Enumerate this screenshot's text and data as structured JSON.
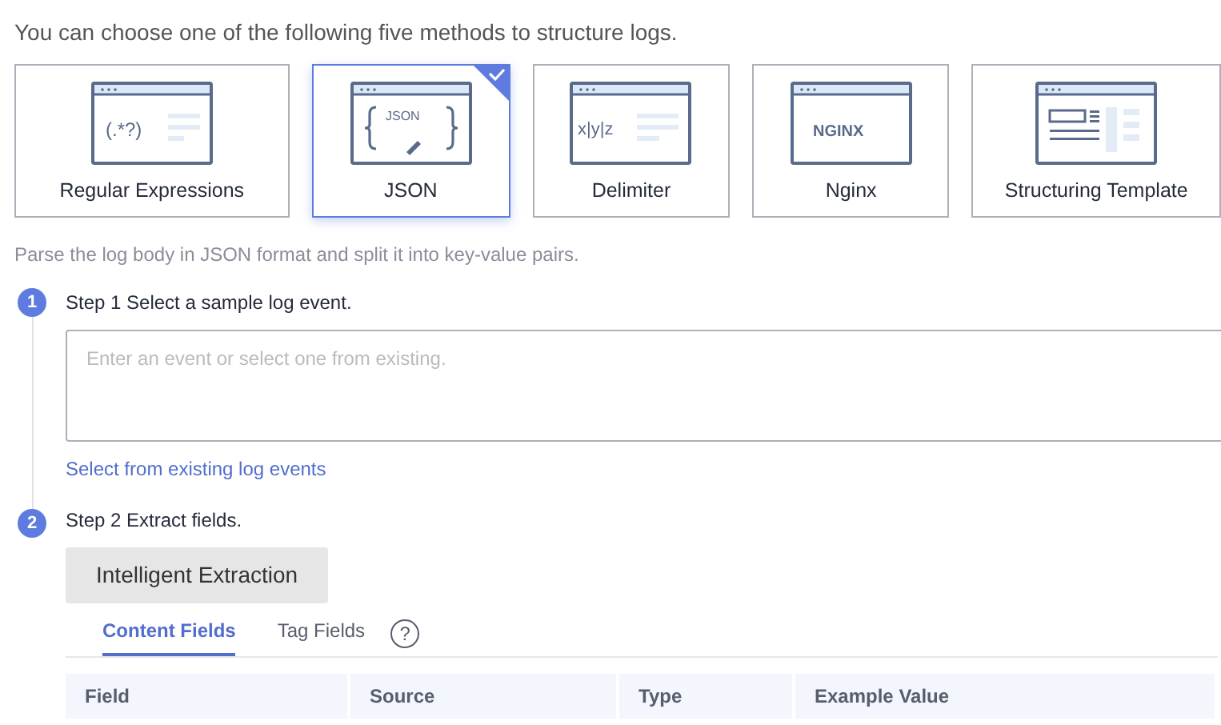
{
  "intro": "You can choose one of the following five methods to structure logs.",
  "methods": [
    {
      "kind": "regex",
      "icon_text": "(.*?)",
      "label": "Regular Expressions",
      "selected": false
    },
    {
      "kind": "json",
      "icon_text": "JSON",
      "label": "JSON",
      "selected": true
    },
    {
      "kind": "delimiter",
      "icon_text": "x|y|z",
      "label": "Delimiter",
      "selected": false
    },
    {
      "kind": "nginx",
      "icon_text": "NGINX",
      "label": "Nginx",
      "selected": false
    },
    {
      "kind": "template",
      "label": "Structuring Template",
      "selected": false
    }
  ],
  "description": "Parse the log body in JSON format and split it into key-value pairs.",
  "steps": [
    {
      "number": "1",
      "title": "Step 1 Select a sample log event.",
      "placeholder": "Enter an event or select one from existing.",
      "link": "Select from existing log events"
    },
    {
      "number": "2",
      "title": "Step 2 Extract fields.",
      "button": "Intelligent Extraction",
      "tabs": [
        {
          "label": "Content Fields",
          "selected": true
        },
        {
          "label": "Tag Fields",
          "selected": false
        }
      ],
      "help_icon": "?",
      "columns": [
        "Field",
        "Source",
        "Type",
        "Example Value"
      ]
    }
  ]
}
